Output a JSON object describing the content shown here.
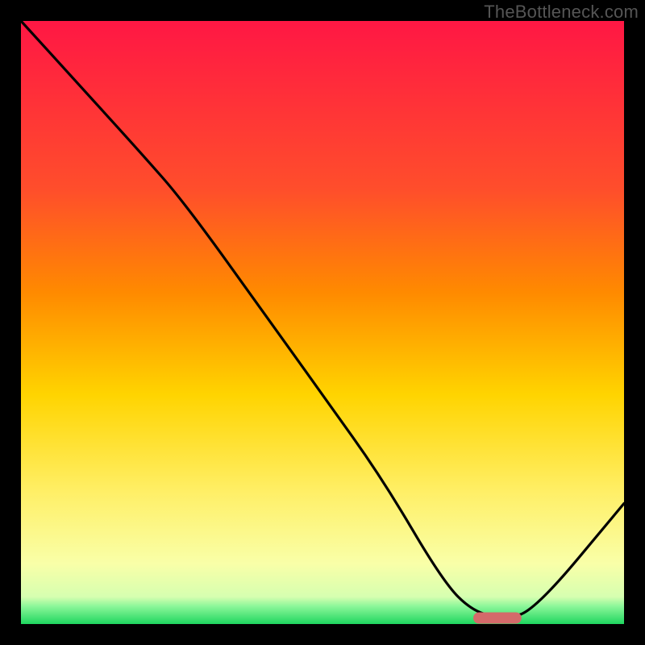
{
  "watermark": "TheBottleneck.com",
  "colors": {
    "stroke": "#000000",
    "marker": "#d46a6a",
    "border": "#000000",
    "bg_top": "#ff1744",
    "bg_mid_upper": "#ff8a00",
    "bg_mid": "#ffd400",
    "bg_mid_low": "#ffef66",
    "bg_low": "#f9ffa8",
    "bg_green": "#1fd65f"
  },
  "chart_data": {
    "type": "line",
    "title": "",
    "xlabel": "",
    "ylabel": "",
    "xlim": [
      0,
      100
    ],
    "ylim": [
      0,
      100
    ],
    "x": [
      0,
      10,
      20,
      27,
      40,
      50,
      60,
      70,
      75,
      80,
      85,
      100
    ],
    "values": [
      100,
      89,
      78,
      70,
      52,
      38,
      24,
      7,
      2,
      1,
      2,
      20
    ],
    "marker": {
      "x_start": 75,
      "x_end": 83,
      "y": 1
    },
    "annotations": []
  }
}
